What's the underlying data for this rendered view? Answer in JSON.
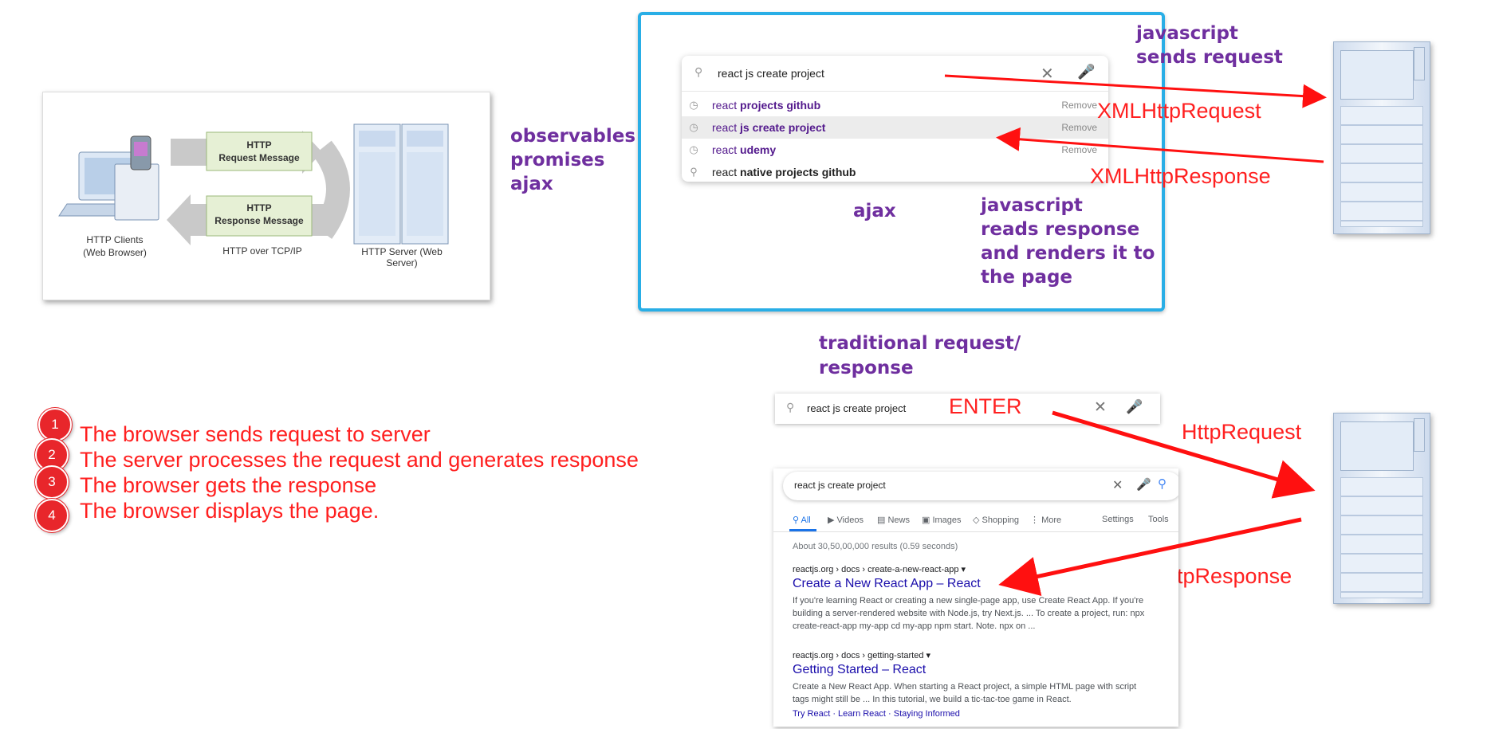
{
  "http_diagram": {
    "request_label": "HTTP\nRequest Message",
    "response_label": "HTTP\nResponse Message",
    "clients_label": "HTTP Clients\n(Web Browser)",
    "transport_label": "HTTP over TCP/IP",
    "server_label": "HTTP Server (Web Server)"
  },
  "concepts": [
    "observables",
    "promises",
    "ajax"
  ],
  "ajax_panel": {
    "search_value": "react js create project",
    "suggestions": [
      {
        "prefix": "react",
        "bold": " projects github",
        "action": "Remove",
        "icon": "history-icon"
      },
      {
        "prefix": "react",
        "bold": " js create project",
        "action": "Remove",
        "icon": "history-icon"
      },
      {
        "prefix": "react",
        "bold": " udemy",
        "action": "Remove",
        "icon": "history-icon"
      },
      {
        "prefix": "react",
        "bold": " native projects github",
        "action": "",
        "icon": "search-icon"
      }
    ],
    "label": "ajax",
    "reads_label": "javascript\nreads response\nand renders it to\nthe page",
    "sends_label": "javascript\nsends request",
    "request_label": "XMLHttpRequest",
    "response_label": "XMLHttpResponse"
  },
  "traditional": {
    "title": "traditional request/\nresponse",
    "search_value": "react js create project",
    "enter_label": "ENTER",
    "request_label": "HttpRequest",
    "response_label": "HttpResponse"
  },
  "steps": [
    {
      "num": "1",
      "text": "The browser sends request to server"
    },
    {
      "num": "2",
      "text": "The server processes the request and generates response"
    },
    {
      "num": "3",
      "text": "The browser gets the response"
    },
    {
      "num": "4",
      "text": "The browser displays the page."
    }
  ],
  "results_page": {
    "search_value": "react js create project",
    "tabs": [
      "All",
      "Videos",
      "News",
      "Images",
      "Shopping",
      "More"
    ],
    "tab_icons": [
      "search-icon",
      "video-icon",
      "news-icon",
      "image-icon",
      "tag-icon",
      "more-icon"
    ],
    "settings": "Settings",
    "tools": "Tools",
    "stats": "About 30,50,00,000 results (0.59 seconds)",
    "result1": {
      "cite": "reactjs.org › docs › create-a-new-react-app",
      "title": "Create a New React App – React",
      "snippet": "If you're learning React or creating a new single-page app, use Create React App. If you're building a server-rendered website with Node.js, try Next.js. ... To create a project, run: npx create-react-app my-app cd my-app npm start. Note. npx on ..."
    },
    "result2": {
      "cite": "reactjs.org › docs › getting-started",
      "title": "Getting Started – React",
      "snippet": "Create a New React App. When starting a React project, a simple HTML page with script tags might still be ... In this tutorial, we build a tic-tac-toe game in React.",
      "links": [
        "Try React",
        "Learn React",
        "Staying Informed"
      ]
    }
  },
  "colors": {
    "accent_purple": "#6f2f9f",
    "accent_red": "#ff2020",
    "frame_blue": "#29aee6",
    "step_circle": "#e8262b"
  }
}
